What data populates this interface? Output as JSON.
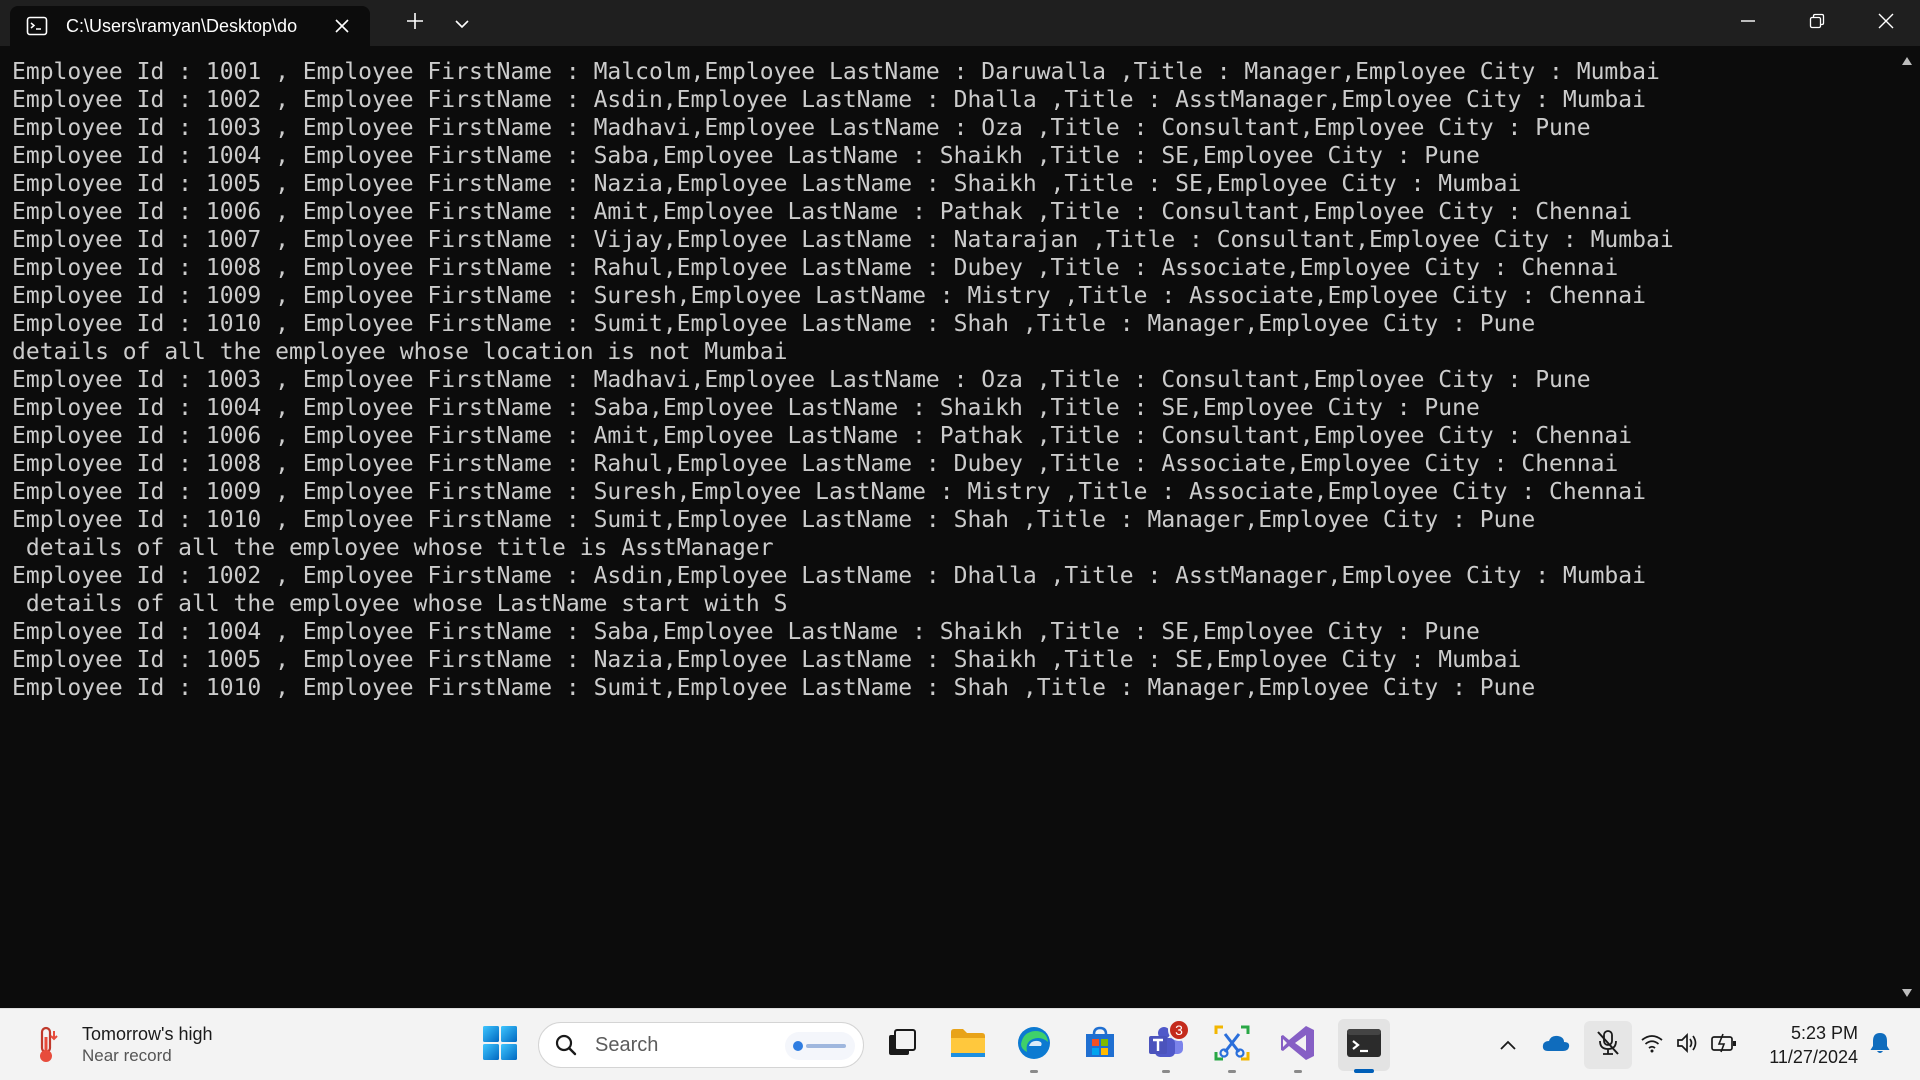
{
  "window": {
    "tab_title": "C:\\Users\\ramyan\\Desktop\\do",
    "icons": {
      "tab": "terminal-icon",
      "close_tab": "close-icon",
      "new_tab": "plus-icon",
      "dropdown": "chevron-down-icon",
      "minimize": "minimize-icon",
      "maximize": "restore-icon",
      "close": "close-icon"
    }
  },
  "terminal": {
    "lines": [
      "Employee Id : 1001 , Employee FirstName : Malcolm,Employee LastName : Daruwalla ,Title : Manager,Employee City : Mumbai",
      "Employee Id : 1002 , Employee FirstName : Asdin,Employee LastName : Dhalla ,Title : AsstManager,Employee City : Mumbai",
      "Employee Id : 1003 , Employee FirstName : Madhavi,Employee LastName : Oza ,Title : Consultant,Employee City : Pune",
      "Employee Id : 1004 , Employee FirstName : Saba,Employee LastName : Shaikh ,Title : SE,Employee City : Pune",
      "Employee Id : 1005 , Employee FirstName : Nazia,Employee LastName : Shaikh ,Title : SE,Employee City : Mumbai",
      "Employee Id : 1006 , Employee FirstName : Amit,Employee LastName : Pathak ,Title : Consultant,Employee City : Chennai",
      "Employee Id : 1007 , Employee FirstName : Vijay,Employee LastName : Natarajan ,Title : Consultant,Employee City : Mumbai",
      "Employee Id : 1008 , Employee FirstName : Rahul,Employee LastName : Dubey ,Title : Associate,Employee City : Chennai",
      "Employee Id : 1009 , Employee FirstName : Suresh,Employee LastName : Mistry ,Title : Associate,Employee City : Chennai",
      "Employee Id : 1010 , Employee FirstName : Sumit,Employee LastName : Shah ,Title : Manager,Employee City : Pune",
      "details of all the employee whose location is not Mumbai",
      "Employee Id : 1003 , Employee FirstName : Madhavi,Employee LastName : Oza ,Title : Consultant,Employee City : Pune",
      "Employee Id : 1004 , Employee FirstName : Saba,Employee LastName : Shaikh ,Title : SE,Employee City : Pune",
      "Employee Id : 1006 , Employee FirstName : Amit,Employee LastName : Pathak ,Title : Consultant,Employee City : Chennai",
      "Employee Id : 1008 , Employee FirstName : Rahul,Employee LastName : Dubey ,Title : Associate,Employee City : Chennai",
      "Employee Id : 1009 , Employee FirstName : Suresh,Employee LastName : Mistry ,Title : Associate,Employee City : Chennai",
      "Employee Id : 1010 , Employee FirstName : Sumit,Employee LastName : Shah ,Title : Manager,Employee City : Pune",
      " details of all the employee whose title is AsstManager",
      "Employee Id : 1002 , Employee FirstName : Asdin,Employee LastName : Dhalla ,Title : AsstManager,Employee City : Mumbai",
      " details of all the employee whose LastName start with S",
      "Employee Id : 1004 , Employee FirstName : Saba,Employee LastName : Shaikh ,Title : SE,Employee City : Pune",
      "Employee Id : 1005 , Employee FirstName : Nazia,Employee LastName : Shaikh ,Title : SE,Employee City : Mumbai",
      "Employee Id : 1010 , Employee FirstName : Sumit,Employee LastName : Shah ,Title : Manager,Employee City : Pune"
    ],
    "colors": {
      "background": "#0c0c0c",
      "foreground": "#cccccc"
    }
  },
  "taskbar": {
    "weather": {
      "title": "Tomorrow's high",
      "subtitle": "Near record",
      "icon": "thermometer-icon"
    },
    "search": {
      "label": "Search"
    },
    "apps": [
      {
        "name": "start",
        "icon": "windows-start-icon"
      },
      {
        "name": "task-view",
        "icon": "task-view-icon"
      },
      {
        "name": "file-explorer",
        "icon": "folder-icon"
      },
      {
        "name": "edge",
        "icon": "edge-icon"
      },
      {
        "name": "store",
        "icon": "store-icon"
      },
      {
        "name": "teams",
        "icon": "teams-icon",
        "badge": "3"
      },
      {
        "name": "snipping-tool",
        "icon": "snipping-tool-icon"
      },
      {
        "name": "visual-studio",
        "icon": "visual-studio-icon"
      },
      {
        "name": "terminal",
        "icon": "terminal-icon"
      }
    ],
    "clock": {
      "time": "5:23 PM",
      "date": "11/27/2024"
    },
    "accent": "#005fb8"
  }
}
